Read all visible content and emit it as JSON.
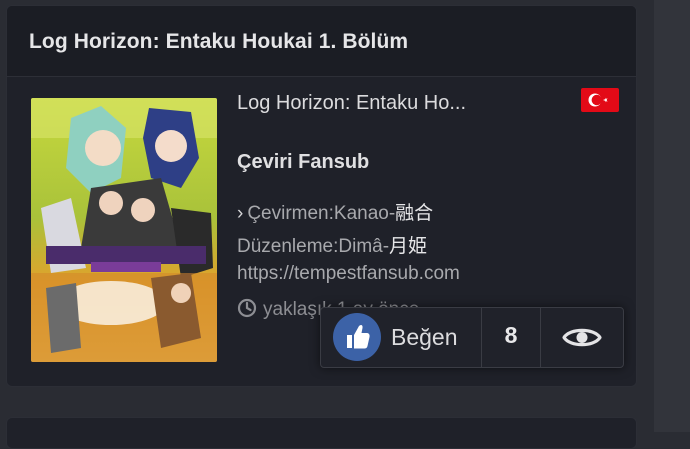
{
  "card": {
    "title": "Log Horizon: Entaku Houkai 1. Bölüm",
    "anime_title": "Log Horizon: Entaku Ho...",
    "flag_icon": "turkey-flag-icon",
    "fansub": "Çeviri Fansub",
    "translator_label": "Çevirmen:Kanao-",
    "translator_cjk": "融合",
    "editor_label": "Düzenleme:Dimâ-",
    "editor_cjk": "月姫",
    "website": "https://tempestfansub.com",
    "time_text": "yaklaşık 1 ay önce"
  },
  "actions": {
    "like_label": "Beğen",
    "like_count": "8",
    "like_icon": "thumbs-up-icon",
    "view_icon": "eye-icon"
  },
  "colors": {
    "like_accent": "#3c62a7",
    "flag_red": "#e30a17"
  }
}
